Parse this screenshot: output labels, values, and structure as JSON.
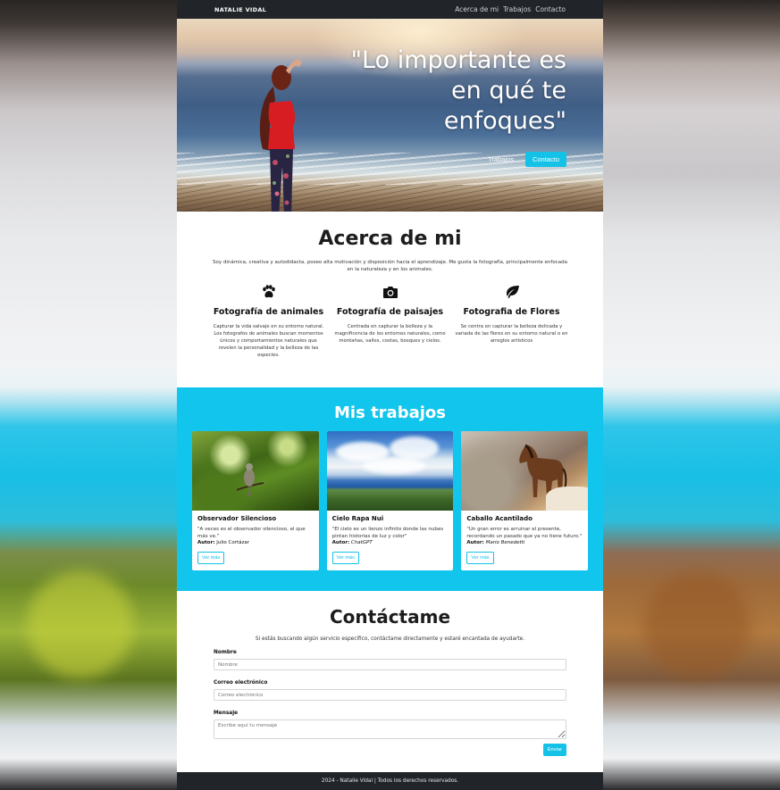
{
  "navbar": {
    "brand": "NATALIE VIDAL",
    "links": [
      "Acerca de mi",
      "Trabajos",
      "Contacto"
    ]
  },
  "hero": {
    "quote": "\"Lo importante es en qué te enfoques\"",
    "buttons": {
      "works": "Trabajos",
      "contact": "Contacto"
    }
  },
  "about": {
    "title": "Acerca de mi",
    "text": "Soy dinámica, creativa y autodidacta, poseo alta motivación y disposición hacia el aprendizaje. Me gusta la fotografía, principalmente enfocada en la naturaleza y en los animales.",
    "features": [
      {
        "icon": "paw-icon",
        "title": "Fotografía de animales",
        "text": "Capturar la vida salvaje en su entorno natural. Los fotografos de animales buscan momentos únicos y comportamientos naturales que revelen la personalidad y la belleza de las especies."
      },
      {
        "icon": "camera-icon",
        "title": "Fotografía de paisajes",
        "text": "Centrada en capturar la belleza y la magnificencia de los entornos naturales, como montañas, valles, costas, bosques y cielos."
      },
      {
        "icon": "leaf-icon",
        "title": "Fotografia de Flores",
        "text": "Se centra en capturar la belleza delicada y variada de las flores en su entorno natural o en arreglos artísticos"
      }
    ]
  },
  "works": {
    "title": "Mis trabajos",
    "cards": [
      {
        "title": "Observador Silencioso",
        "quote": "\"A veces es el observador silencioso, el que más ve.\"",
        "author_label": "Autor:",
        "author": "Julio Cortázar",
        "author_italic": false,
        "button": "Ver más"
      },
      {
        "title": "Cielo Rapa Nui",
        "quote": "\"El cielo es un lienzo infinito donde las nubes pintan historias de luz y color\"",
        "author_label": "Autor:",
        "author": "ChatGPT",
        "author_italic": true,
        "button": "Ver más"
      },
      {
        "title": "Caballo Acantilado",
        "quote": "\"Un gran error es arruinar el presente, recordando un pasado que ya no tiene futuro.\"",
        "author_label": "Autor:",
        "author": "Mario Benedetti",
        "author_italic": true,
        "button": "Ver más"
      }
    ]
  },
  "contact": {
    "title": "Contáctame",
    "text": "Si estás buscando algún servicio específico, contáctame directamente y estaré encantada de ayudarte.",
    "fields": {
      "name_label": "Nombre",
      "name_placeholder": "Nombre",
      "email_label": "Correo electrónico",
      "email_placeholder": "Correo electrónico",
      "message_label": "Mensaje",
      "message_placeholder": "Escribe aquí tu mensaje"
    },
    "submit": "Enviar"
  },
  "footer": {
    "text": "2024 - Natalie Vidal | Todos los derechos reservados."
  },
  "colors": {
    "accent": "#13c2e6",
    "dark": "#212529"
  }
}
